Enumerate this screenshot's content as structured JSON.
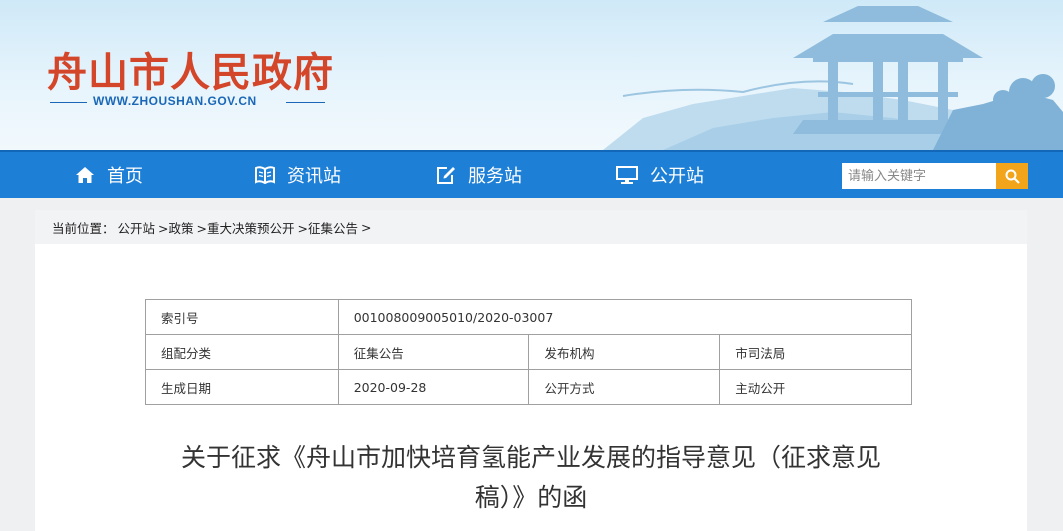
{
  "header": {
    "site_title": "舟山市人民政府",
    "site_url": "WWW.ZHOUSHAN.GOV.CN"
  },
  "nav": {
    "items": [
      {
        "label": "首页",
        "icon": "home-icon"
      },
      {
        "label": "资讯站",
        "icon": "book-icon"
      },
      {
        "label": "服务站",
        "icon": "edit-icon"
      },
      {
        "label": "公开站",
        "icon": "monitor-icon"
      }
    ],
    "search_placeholder": "请输入关键字"
  },
  "breadcrumb": {
    "prefix": "当前位置：",
    "items": [
      "公开站",
      ">政策",
      ">重大决策预公开",
      ">征集公告",
      ">"
    ]
  },
  "meta": {
    "index_label": "索引号",
    "index_value": "001008009005010/2020-03007",
    "category_label": "组配分类",
    "category_value": "征集公告",
    "publisher_label": "发布机构",
    "publisher_value": "市司法局",
    "date_label": "生成日期",
    "date_value": "2020-09-28",
    "disclosure_label": "公开方式",
    "disclosure_value": "主动公开"
  },
  "document": {
    "title_line1": "关于征求《舟山市加快培育氢能产业发展的指导意见（征求意见",
    "title_line2": "稿）》的函"
  },
  "colors": {
    "title_red": "#d4462a",
    "nav_blue": "#1e7fd6",
    "search_orange": "#f2a51a"
  }
}
